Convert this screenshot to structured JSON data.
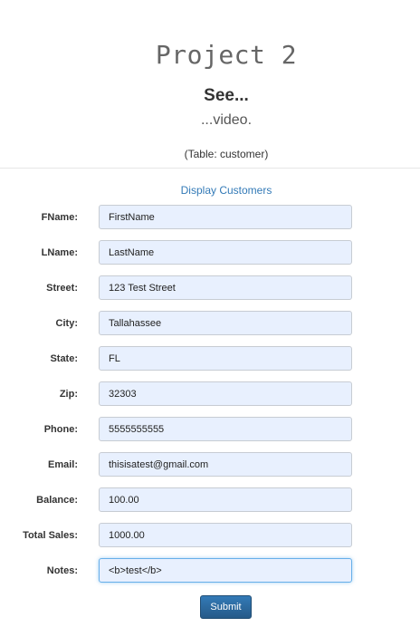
{
  "header": {
    "title": "Project 2",
    "subtitle": "See...",
    "lead": "...video.",
    "table_note": "(Table: customer)"
  },
  "nav": {
    "display_customers": "Display Customers"
  },
  "form": {
    "fields": [
      {
        "label": "FName:",
        "value": "FirstName"
      },
      {
        "label": "LName:",
        "value": "LastName"
      },
      {
        "label": "Street:",
        "value": "123 Test Street"
      },
      {
        "label": "City:",
        "value": "Tallahassee"
      },
      {
        "label": "State:",
        "value": "FL"
      },
      {
        "label": "Zip:",
        "value": "32303"
      },
      {
        "label": "Phone:",
        "value": "5555555555"
      },
      {
        "label": "Email:",
        "value": "thisisatest@gmail.com"
      },
      {
        "label": "Balance:",
        "value": "100.00"
      },
      {
        "label": "Total Sales:",
        "value": "1000.00"
      },
      {
        "label": "Notes:",
        "value": "<b>test</b>"
      }
    ],
    "submit_label": "Submit"
  },
  "colors": {
    "link": "#337ab7",
    "button": "#2b6ca3",
    "input_background": "#e8f0fe"
  }
}
